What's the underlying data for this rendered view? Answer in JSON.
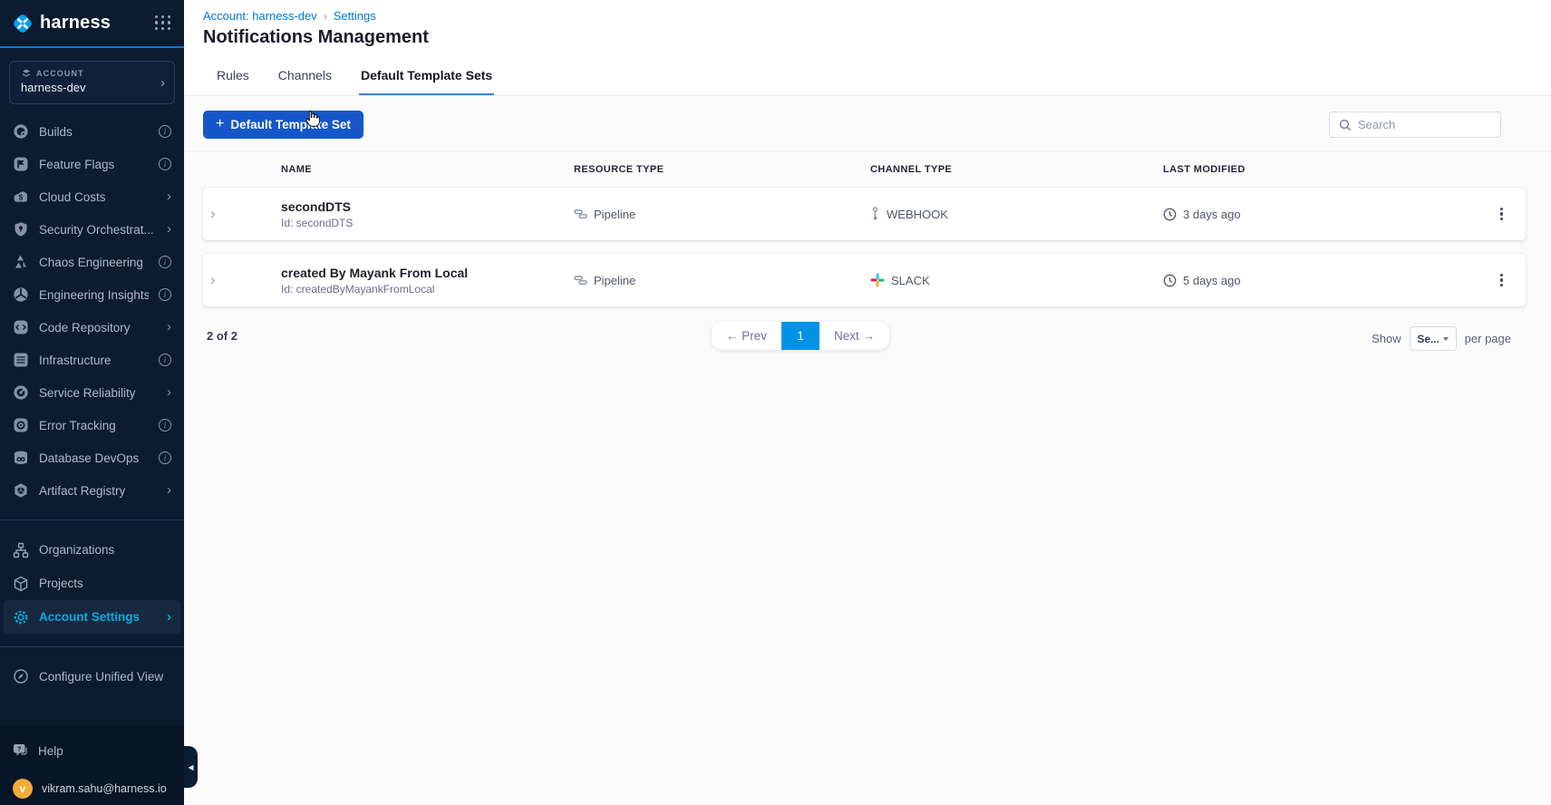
{
  "sidebar": {
    "logo_text": "harness",
    "account_label": "ACCOUNT",
    "account_name": "harness-dev",
    "account_chevron": "›",
    "nav_items": [
      {
        "label": "Builds",
        "accessory": "info"
      },
      {
        "label": "Feature Flags",
        "accessory": "info"
      },
      {
        "label": "Cloud Costs",
        "accessory": "chevron"
      },
      {
        "label": "Security Orchestrat...",
        "accessory": "chevron"
      },
      {
        "label": "Chaos Engineering",
        "accessory": "info"
      },
      {
        "label": "Engineering Insights",
        "accessory": "info"
      },
      {
        "label": "Code Repository",
        "accessory": "chevron"
      },
      {
        "label": "Infrastructure",
        "accessory": "info"
      },
      {
        "label": "Service Reliability",
        "accessory": "chevron"
      },
      {
        "label": "Error Tracking",
        "accessory": "info"
      },
      {
        "label": "Database DevOps",
        "accessory": "info"
      },
      {
        "label": "Artifact Registry",
        "accessory": "chevron"
      }
    ],
    "secondary_items": [
      {
        "label": "Organizations"
      },
      {
        "label": "Projects"
      },
      {
        "label": "Account Settings",
        "active": true
      }
    ],
    "configure_label": "Configure Unified View",
    "help_label": "Help",
    "user_email": "vikram.sahu@harness.io",
    "avatar_initial": "v",
    "info_glyph": "i",
    "chevron_glyph": "›",
    "collapse_glyph": "◀"
  },
  "header": {
    "breadcrumb": [
      {
        "label": "Account: harness-dev"
      },
      {
        "label": "Settings"
      }
    ],
    "breadcrumb_separator": "›",
    "title": "Notifications Management",
    "tabs": [
      {
        "label": "Rules",
        "active": false
      },
      {
        "label": "Channels",
        "active": false
      },
      {
        "label": "Default Template Sets",
        "active": true
      }
    ]
  },
  "toolbar": {
    "add_button_label": "Default Template Set",
    "add_button_plus": "+",
    "search_placeholder": "Search"
  },
  "table": {
    "columns": [
      "NAME",
      "RESOURCE TYPE",
      "CHANNEL TYPE",
      "LAST MODIFIED"
    ],
    "row_expander_glyph": "›",
    "rows": [
      {
        "name": "secondDTS",
        "id": "Id: secondDTS",
        "resource_type": "Pipeline",
        "channel_type": "WEBHOOK",
        "channel_icon": "webhook-icon",
        "last_modified": "3 days ago"
      },
      {
        "name": "created By Mayank From Local",
        "id": "Id: createdByMayankFromLocal",
        "resource_type": "Pipeline",
        "channel_type": "SLACK",
        "channel_icon": "slack-icon",
        "last_modified": "5 days ago"
      }
    ]
  },
  "pagination": {
    "count_text": "2 of 2",
    "prev_label": "← Prev",
    "page": "1",
    "next_label": "Next →",
    "show_label": "Show",
    "page_size_value": "Se...",
    "per_page_label": "per page"
  },
  "colors": {
    "sidebar_bg": "#0b1c31",
    "sidebar_bottom_bg": "#081527",
    "sidebar_active_text": "#00ade4",
    "logo_underline": "#0278d5",
    "link_blue": "#0278d5",
    "primary_button": "#1557c9",
    "active_page": "#0092e4",
    "tab_underline": "#3c82dd",
    "avatar_bg": "#f3ab3c",
    "slack_colors": [
      "#36C5F0",
      "#2EB67D",
      "#ECB22E",
      "#E01E5A"
    ]
  }
}
